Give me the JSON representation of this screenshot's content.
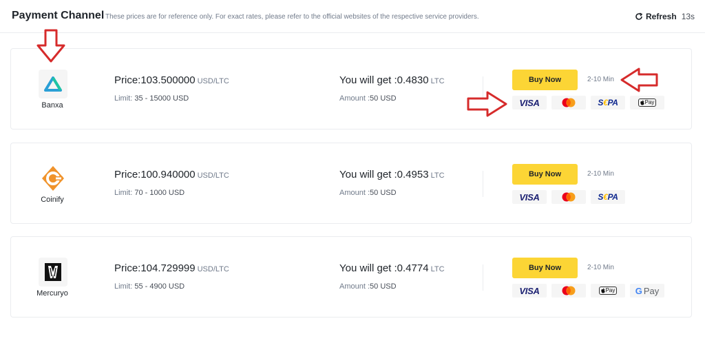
{
  "header": {
    "title": "Payment Channel",
    "subtitle": "These prices are for reference only. For exact rates, please refer to the official websites of the respective service providers.",
    "refresh_label": "Refresh",
    "refresh_seconds": "13s"
  },
  "providers": [
    {
      "name": "Banxa",
      "price_label": "Price:",
      "price": "103.500000",
      "price_unit": "USD/LTC",
      "limit_label": "Limit:",
      "limit": "35 - 15000 USD",
      "get_label": "You will get :",
      "get_value": "0.4830",
      "get_unit": "LTC",
      "amount_label": "Amount :",
      "amount": "50 USD",
      "buy_label": "Buy Now",
      "eta": "2-10 Min",
      "payment_methods": [
        "visa",
        "mastercard",
        "sepa",
        "apple-pay"
      ]
    },
    {
      "name": "Coinify",
      "price_label": "Price:",
      "price": "100.940000",
      "price_unit": "USD/LTC",
      "limit_label": "Limit:",
      "limit": "70 - 1000 USD",
      "get_label": "You will get :",
      "get_value": "0.4953",
      "get_unit": "LTC",
      "amount_label": "Amount :",
      "amount": "50 USD",
      "buy_label": "Buy Now",
      "eta": "2-10 Min",
      "payment_methods": [
        "visa",
        "mastercard",
        "sepa"
      ]
    },
    {
      "name": "Mercuryo",
      "price_label": "Price:",
      "price": "104.729999",
      "price_unit": "USD/LTC",
      "limit_label": "Limit:",
      "limit": "55 - 4900 USD",
      "get_label": "You will get :",
      "get_value": "0.4774",
      "get_unit": "LTC",
      "amount_label": "Amount :",
      "amount": "50 USD",
      "buy_label": "Buy Now",
      "eta": "2-10 Min",
      "payment_methods": [
        "visa",
        "mastercard",
        "apple-pay",
        "google-pay"
      ]
    }
  ],
  "payment_labels": {
    "visa": "VISA",
    "sepa_s": "S",
    "sepa_e": "€",
    "sepa_pa": "PA",
    "apple_pay": "Pay",
    "google_pay": "Pay",
    "google_g": "G"
  },
  "colors": {
    "buy_button": "#fcd535",
    "annotation_arrow": "#d62b2b",
    "banxa_brand": "#2a9fd6",
    "coinify_brand": "#f0932b"
  }
}
